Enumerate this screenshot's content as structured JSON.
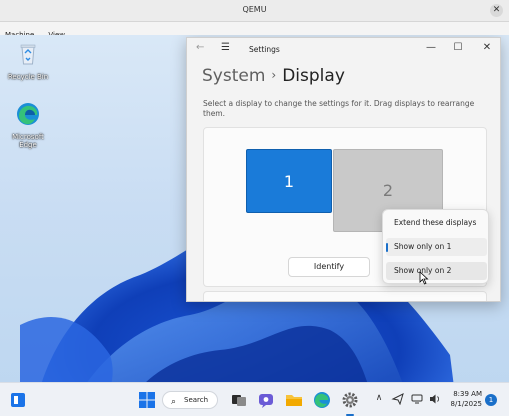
{
  "qemu": {
    "title": "QEMU",
    "close_glyph": "✕",
    "menu": [
      "Machine",
      "View"
    ]
  },
  "desktop": {
    "icons": [
      {
        "label": "Recycle Bin",
        "icon": "recycle-bin-icon"
      },
      {
        "label": "Microsoft Edge",
        "icon": "edge-icon"
      }
    ]
  },
  "settings": {
    "app_title": "Settings",
    "back_glyph": "←",
    "menu_glyph": "☰",
    "controls": {
      "minimize": "—",
      "maximize": "☐",
      "close": "✕"
    },
    "breadcrumb": {
      "parent": "System",
      "separator": "›",
      "current": "Display"
    },
    "description": "Select a display to change the settings for it. Drag displays to rearrange them.",
    "monitors": [
      {
        "label": "1",
        "selected": true
      },
      {
        "label": "2",
        "selected": false
      }
    ],
    "identify_label": "Identify",
    "context_menu": {
      "items": [
        "Extend these displays",
        "Show only on 1",
        "Show only on 2"
      ],
      "selected_index": 1,
      "hover_index": 2
    }
  },
  "taskbar": {
    "search_label": "Search",
    "search_glyph": "⌕",
    "tray": {
      "chevron": "∧"
    },
    "time": "8:39 AM",
    "date": "8/1/2025",
    "notification_count": "1",
    "accent": "#1a6fc9"
  }
}
